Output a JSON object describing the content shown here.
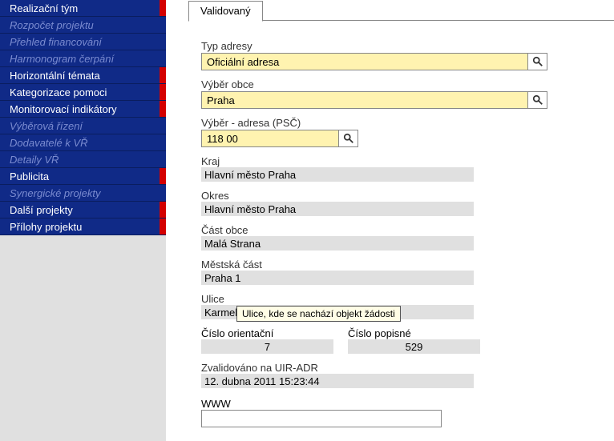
{
  "sidebar": {
    "items": [
      {
        "label": "Realizační tým",
        "dim": false,
        "mark": true
      },
      {
        "label": "Rozpočet projektu",
        "dim": true,
        "mark": false
      },
      {
        "label": "Přehled financování",
        "dim": true,
        "mark": false
      },
      {
        "label": "Harmonogram čerpání",
        "dim": true,
        "mark": false
      },
      {
        "label": "Horizontální témata",
        "dim": false,
        "mark": true
      },
      {
        "label": "Kategorizace pomoci",
        "dim": false,
        "mark": true
      },
      {
        "label": "Monitorovací indikátory",
        "dim": false,
        "mark": true
      },
      {
        "label": "Výběrová řízení",
        "dim": true,
        "mark": false
      },
      {
        "label": "Dodavatelé k VŘ",
        "dim": true,
        "mark": false
      },
      {
        "label": "Detaily VŘ",
        "dim": true,
        "mark": false
      },
      {
        "label": "Publicita",
        "dim": false,
        "mark": true
      },
      {
        "label": "Synergické projekty",
        "dim": true,
        "mark": false
      },
      {
        "label": "Další projekty",
        "dim": false,
        "mark": true
      },
      {
        "label": "Přílohy projektu",
        "dim": false,
        "mark": true
      }
    ]
  },
  "tab": {
    "label": "Validovaný"
  },
  "form": {
    "typ_adresy_label": "Typ adresy",
    "typ_adresy_value": "Oficiální adresa",
    "vyber_obce_label": "Výběr obce",
    "vyber_obce_value": "Praha",
    "vyber_psc_label": "Výběr - adresa (PSČ)",
    "vyber_psc_value": "118 00",
    "kraj_label": "Kraj",
    "kraj_value": "Hlavní město Praha",
    "okres_label": "Okres",
    "okres_value": "Hlavní město Praha",
    "cast_obce_label": "Část obce",
    "cast_obce_value": "Malá Strana",
    "mestska_cast_label": "Městská část",
    "mestska_cast_value": "Praha 1",
    "ulice_label": "Ulice",
    "ulice_value": "Karmelitská",
    "cislo_orientacni_label": "Číslo orientační",
    "cislo_orientacni_value": "7",
    "cislo_popisne_label": "Číslo popisné",
    "cislo_popisne_value": "529",
    "zvalidovano_label": "Zvalidováno na UIR-ADR",
    "zvalidovano_value": "12. dubna 2011 15:23:44",
    "www_label": "WWW",
    "www_value": ""
  },
  "tooltip": "Ulice, kde se nachází objekt žádosti"
}
